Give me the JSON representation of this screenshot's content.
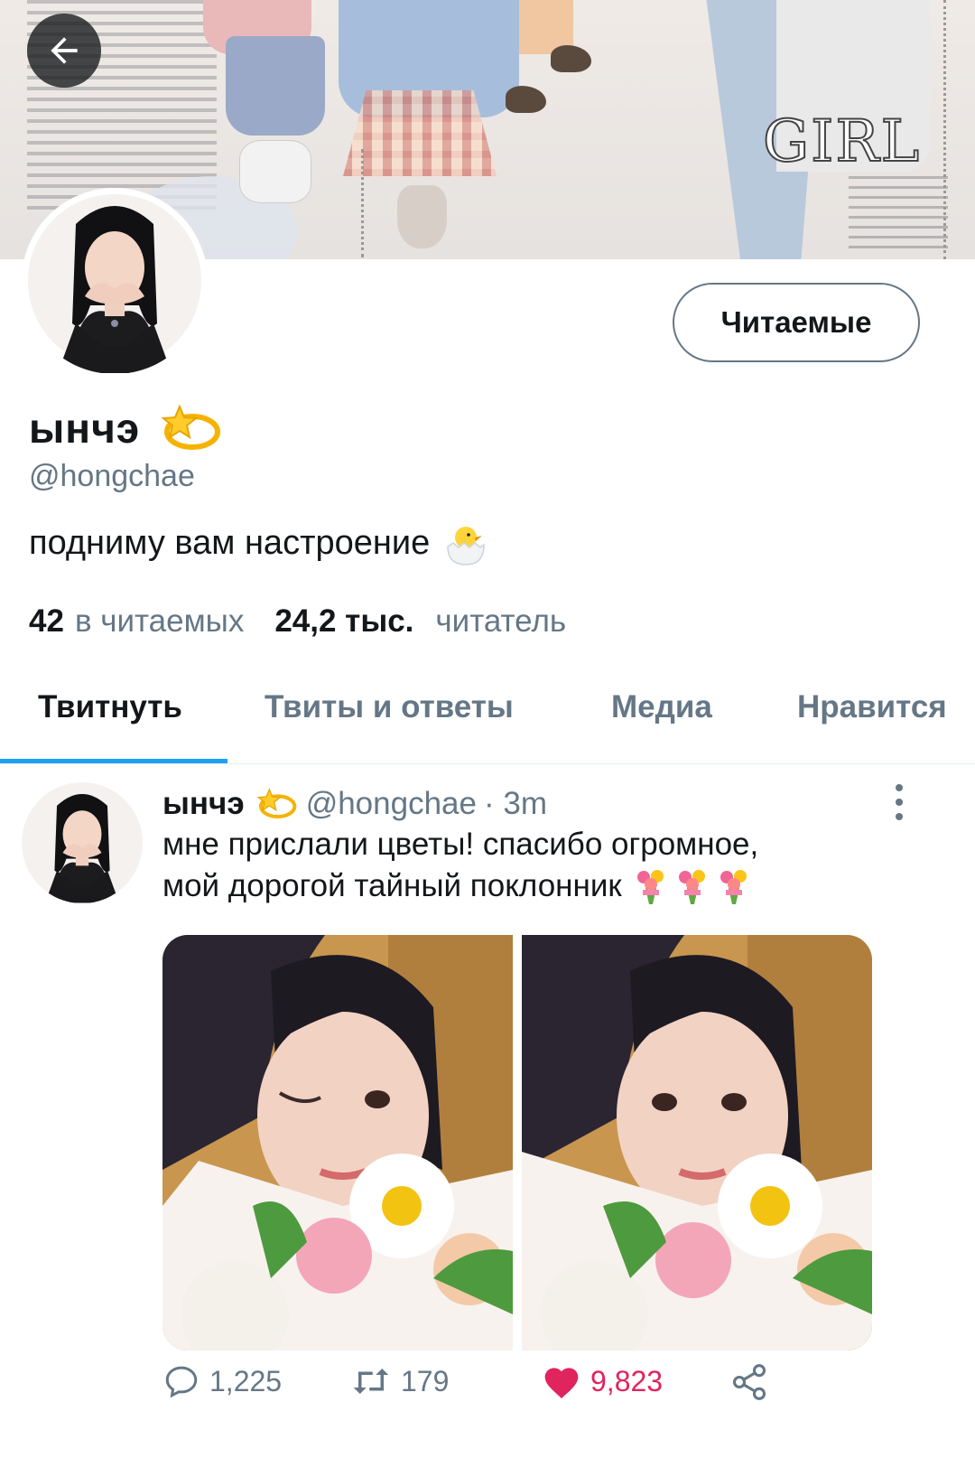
{
  "profile": {
    "display_name": "ынчэ",
    "name_emoji": "dizzy-emoji",
    "handle": "@hongchae",
    "bio": "подниму вам настроение",
    "bio_emoji": "hatching-chick-emoji",
    "follow_button": "Читаемые",
    "following_count": "42",
    "following_label": "в читаемых",
    "followers_count": "24,2 тыс.",
    "followers_label": "читатель"
  },
  "banner": {
    "girl_text": "GIRL"
  },
  "tabs": [
    {
      "label": "Твитнуть",
      "active": true
    },
    {
      "label": "Твиты и ответы",
      "active": false
    },
    {
      "label": "Медиа",
      "active": false
    },
    {
      "label": "Нравится",
      "active": false
    }
  ],
  "tweet": {
    "name": "ынчэ",
    "handle": "@hongchae",
    "time": "· 3m",
    "text_line1": "мне прислали цветы! спасибо огромное,",
    "text_line2": "мой дорогой тайный поклонник",
    "text_emoji": "bouquet-emoji",
    "replies": "1,225",
    "retweets": "179",
    "likes": "9,823",
    "liked": true
  },
  "colors": {
    "accent": "#1da1f2",
    "secondary_text": "#657786",
    "like": "#e0245e"
  }
}
